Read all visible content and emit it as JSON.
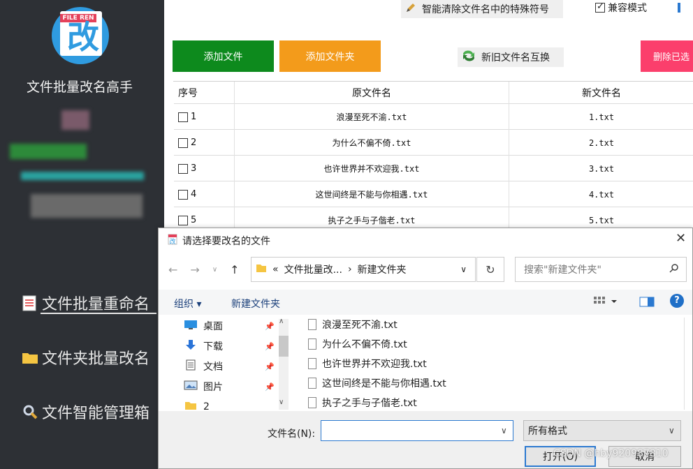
{
  "sidebar": {
    "logo_tag": "FILE REN",
    "logo_char": "改",
    "app_title": "文件批量改名高手",
    "nav": [
      {
        "label": "文件批量重命名",
        "active": true
      },
      {
        "label": "文件夹批量改名",
        "active": false
      },
      {
        "label": "文件智能管理箱",
        "active": false
      }
    ]
  },
  "topbar": {
    "clean_label": "智能清除文件名中的特殊符号",
    "compat_label": "兼容模式",
    "compat_checked": true
  },
  "toolbar": {
    "add_file": "添加文件",
    "add_folder": "添加文件夹",
    "swap": "新旧文件名互换",
    "delete": "删除已选",
    "colors": {
      "add_file": "#0d8a1d",
      "add_folder": "#f39b1b",
      "delete": "#fb3f6c"
    }
  },
  "table": {
    "headers": [
      "序号",
      "原文件名",
      "新文件名"
    ],
    "rows": [
      {
        "num": "1",
        "original": "浪漫至死不渝.txt",
        "new": "1.txt"
      },
      {
        "num": "2",
        "original": "为什么不偏不倚.txt",
        "new": "2.txt"
      },
      {
        "num": "3",
        "original": "也许世界并不欢迎我.txt",
        "new": "3.txt"
      },
      {
        "num": "4",
        "original": "这世间终是不能与你相遇.txt",
        "new": "4.txt"
      },
      {
        "num": "5",
        "original": "执子之手与子偕老.txt",
        "new": "5.txt"
      }
    ]
  },
  "dialog": {
    "title": "请选择要改名的文件",
    "address": [
      "文件批量改...",
      "新建文件夹"
    ],
    "address_prefix": "«",
    "search_placeholder": "搜索\"新建文件夹\"",
    "toolbar": {
      "organize": "组织 ▾",
      "new_folder": "新建文件夹"
    },
    "tree": [
      {
        "label": "桌面",
        "icon": "desktop-icon",
        "pinned": true
      },
      {
        "label": "下载",
        "icon": "download-icon",
        "pinned": true
      },
      {
        "label": "文档",
        "icon": "document-icon",
        "pinned": true
      },
      {
        "label": "图片",
        "icon": "picture-icon",
        "pinned": true
      },
      {
        "label": "2",
        "icon": "folder-icon",
        "pinned": false
      }
    ],
    "files": [
      "浪漫至死不渝.txt",
      "为什么不偏不倚.txt",
      "也许世界并不欢迎我.txt",
      "这世间终是不能与你相遇.txt",
      "执子之手与子偕老.txt"
    ],
    "filename_label": "文件名(N):",
    "filename_value": "",
    "filter": "所有格式",
    "open": "打开(O)",
    "cancel": "取消"
  },
  "watermark": "CSDN @hby920987810"
}
